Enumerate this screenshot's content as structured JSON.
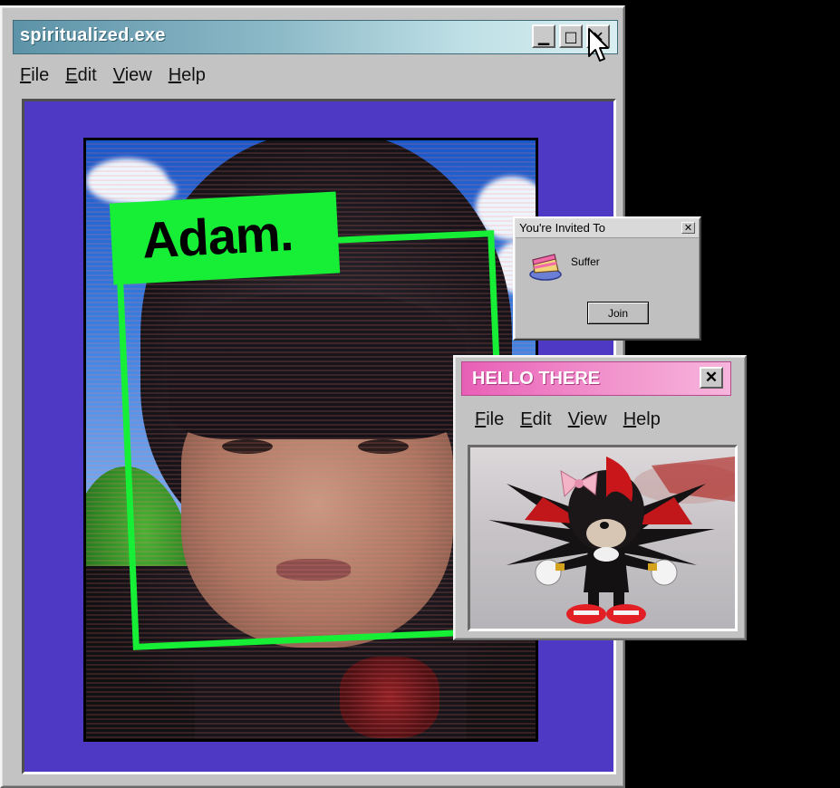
{
  "main_window": {
    "title": "spiritualized.exe",
    "menu": [
      "File",
      "Edit",
      "View",
      "Help"
    ],
    "controls": {
      "minimize": "▁",
      "maximize": "□",
      "close": "✕"
    }
  },
  "photo": {
    "label": "Adam."
  },
  "invite_dialog": {
    "title": "You're Invited To",
    "close": "✕",
    "event": "Suffer",
    "join_label": "Join"
  },
  "hello_window": {
    "title": "HELLO THERE",
    "close": "✕",
    "menu": [
      "File",
      "Edit",
      "View",
      "Help"
    ]
  },
  "colors": {
    "content_bg": "#4e39c5",
    "frame_green": "#17ef37",
    "hello_pink": "#e85fb6"
  }
}
